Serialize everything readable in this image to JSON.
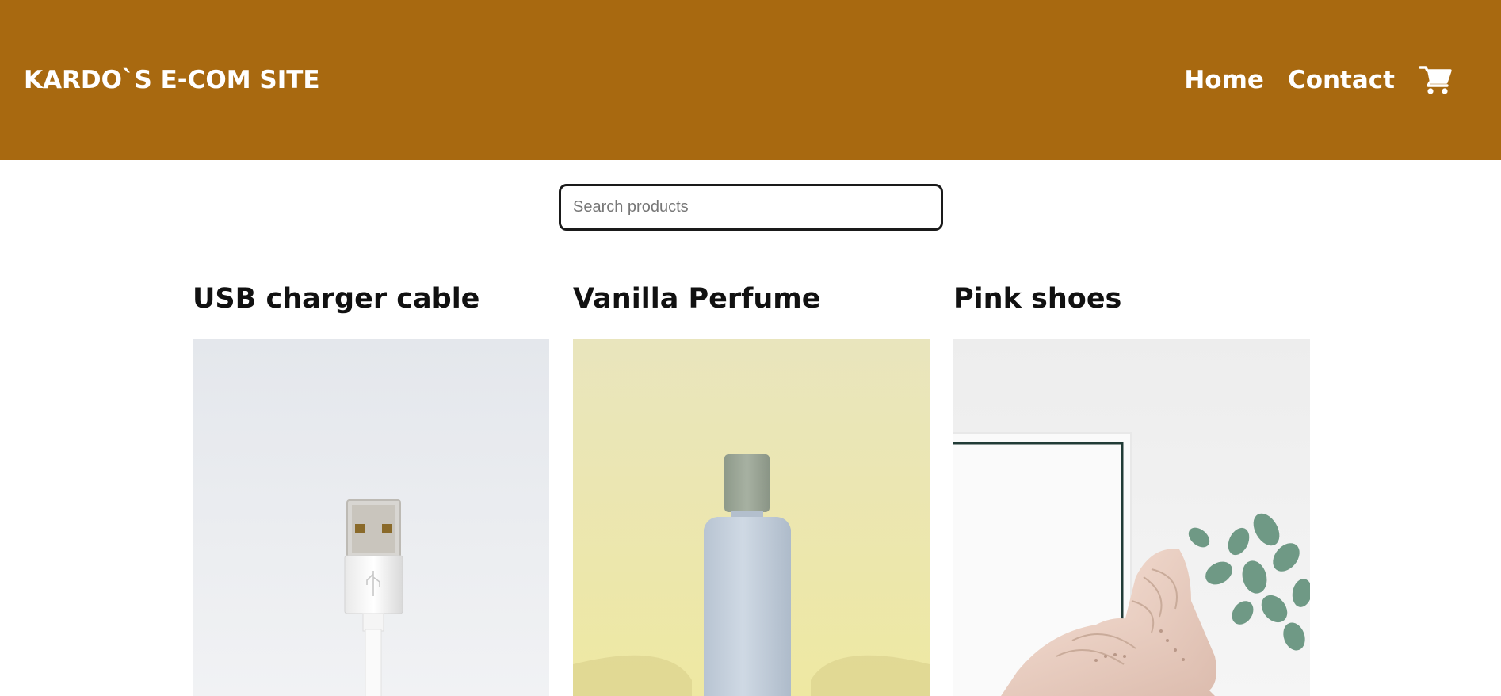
{
  "header": {
    "logo": "KARDO`S E-COM SITE",
    "nav": {
      "home": "Home",
      "contact": "Contact"
    },
    "cart_icon": "shopping-cart-icon",
    "background_color": "#a86910"
  },
  "search": {
    "placeholder": "Search products",
    "value": ""
  },
  "products": [
    {
      "title": "USB charger cable",
      "image": "usb-cable-photo"
    },
    {
      "title": "Vanilla Perfume",
      "image": "perfume-bottle-photo"
    },
    {
      "title": "Pink shoes",
      "image": "pink-shoes-photo"
    }
  ]
}
